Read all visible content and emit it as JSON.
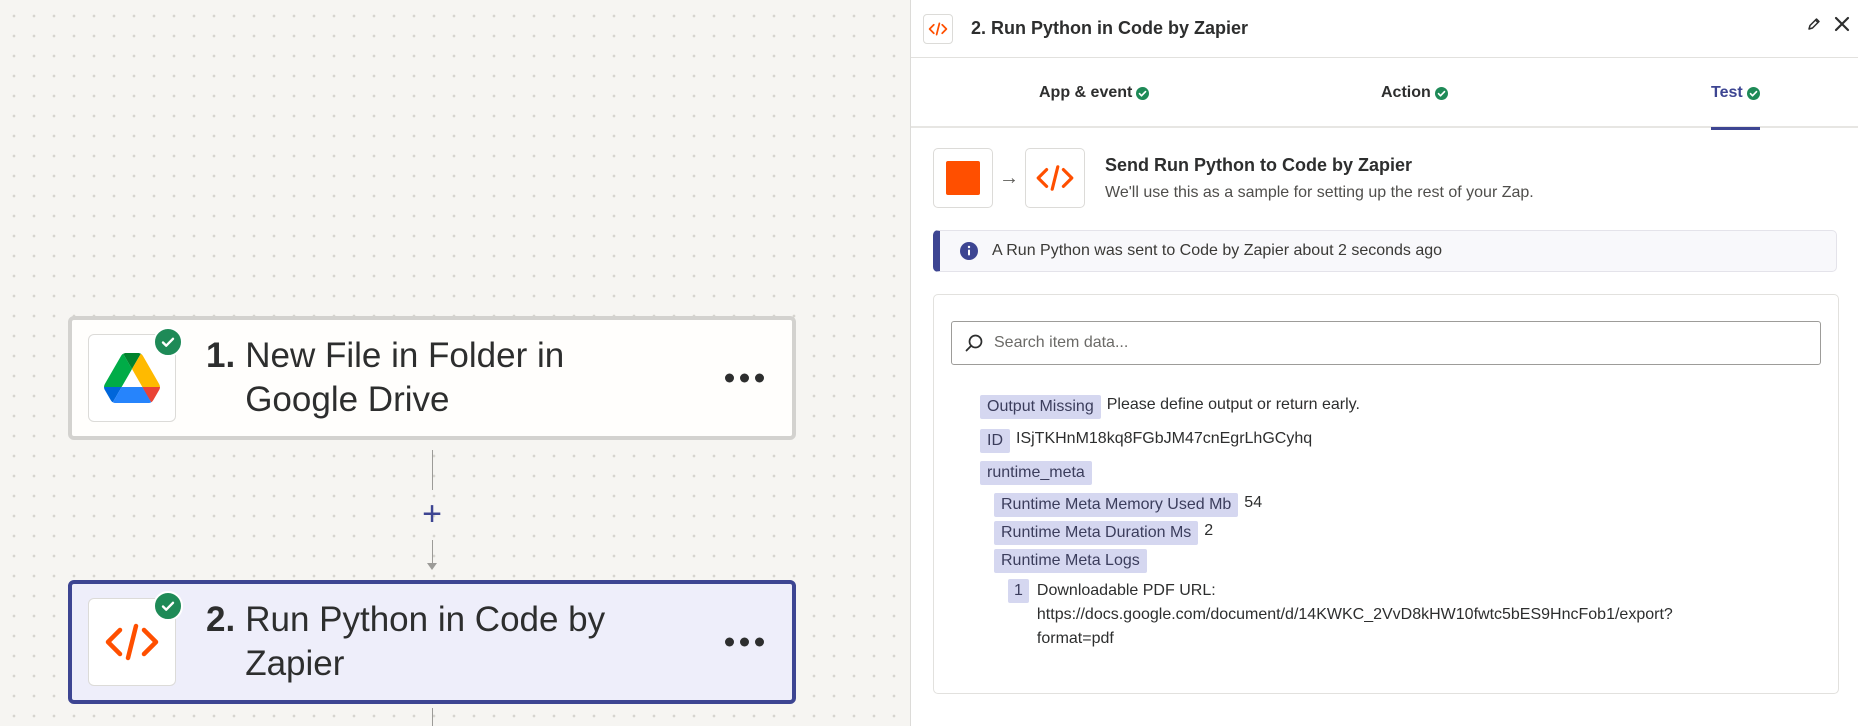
{
  "canvas": {
    "steps": [
      {
        "number": "1.",
        "title": "New File in Folder in Google Drive",
        "app_icon": "google-drive-icon"
      },
      {
        "number": "2.",
        "title": "Run Python in Code by Zapier",
        "app_icon": "code-icon"
      }
    ],
    "add_step_glyph": "+"
  },
  "panel": {
    "header": {
      "title": "2. Run Python in Code by Zapier"
    },
    "tabs": [
      {
        "label": "App & event"
      },
      {
        "label": "Action"
      },
      {
        "label": "Test"
      }
    ],
    "send": {
      "title": "Send Run Python to Code by Zapier",
      "subtitle": "We'll use this as a sample for setting up the rest of your Zap."
    },
    "info": {
      "message": "A Run Python was sent to Code by Zapier about 2 seconds ago"
    },
    "search": {
      "placeholder": "Search item data..."
    },
    "data": {
      "output_missing": {
        "key": "Output Missing",
        "value": "Please define output or return early."
      },
      "id": {
        "key": "ID",
        "value": "ISjTKHnM18kq8FGbJM47cnEgrLhGCyhq"
      },
      "runtime_meta": {
        "key": "runtime_meta"
      },
      "memory": {
        "key": "Runtime Meta Memory Used Mb",
        "value": "54"
      },
      "duration": {
        "key": "Runtime Meta Duration Ms",
        "value": "2"
      },
      "logs": {
        "key": "Runtime Meta Logs"
      },
      "log_item": {
        "key": "1",
        "line1": "Downloadable PDF URL:",
        "line2": "https://docs.google.com/document/d/14KWKC_2VvD8kHW10fwtc5bES9HncFob1/export?",
        "line3": "format=pdf"
      }
    }
  },
  "colors": {
    "accent": "#3d4592",
    "success": "#1e8a57",
    "code_orange": "#ff4f00",
    "key_chip": "#d5d7f0"
  }
}
